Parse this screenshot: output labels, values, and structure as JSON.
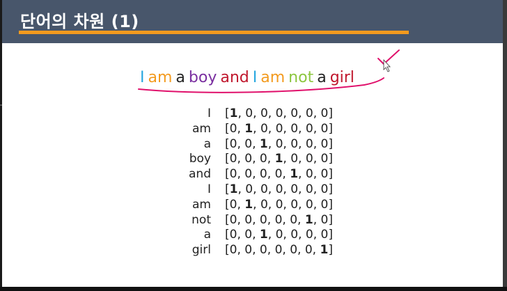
{
  "slide": {
    "title": "단어의 차원 (1)",
    "colors": {
      "title_bar": "#48566b",
      "title_underline": "#f39a1e",
      "annotation": "#e0106b"
    }
  },
  "sentence": {
    "words": [
      {
        "text": "I",
        "color": "#29a8e0"
      },
      {
        "text": "am",
        "color": "#f39a1e"
      },
      {
        "text": "a",
        "color": "#222222"
      },
      {
        "text": "boy",
        "color": "#7a2fa0"
      },
      {
        "text": "and",
        "color": "#c0162c"
      },
      {
        "text": "I",
        "color": "#29a8e0"
      },
      {
        "text": "am",
        "color": "#f39a1e"
      },
      {
        "text": "not",
        "color": "#8cc63f"
      },
      {
        "text": "a",
        "color": "#222222"
      },
      {
        "text": "girl",
        "color": "#c0162c"
      }
    ]
  },
  "encodings": [
    {
      "word": "I",
      "vector": [
        1,
        0,
        0,
        0,
        0,
        0,
        0
      ]
    },
    {
      "word": "am",
      "vector": [
        0,
        1,
        0,
        0,
        0,
        0,
        0
      ]
    },
    {
      "word": "a",
      "vector": [
        0,
        0,
        1,
        0,
        0,
        0,
        0
      ]
    },
    {
      "word": "boy",
      "vector": [
        0,
        0,
        0,
        1,
        0,
        0,
        0
      ]
    },
    {
      "word": "and",
      "vector": [
        0,
        0,
        0,
        0,
        1,
        0,
        0
      ]
    },
    {
      "word": "I",
      "vector": [
        1,
        0,
        0,
        0,
        0,
        0,
        0
      ]
    },
    {
      "word": "am",
      "vector": [
        0,
        1,
        0,
        0,
        0,
        0,
        0
      ]
    },
    {
      "word": "not",
      "vector": [
        0,
        0,
        0,
        0,
        0,
        1,
        0
      ]
    },
    {
      "word": "a",
      "vector": [
        0,
        0,
        1,
        0,
        0,
        0,
        0
      ]
    },
    {
      "word": "girl",
      "vector": [
        0,
        0,
        0,
        0,
        0,
        0,
        1
      ]
    }
  ]
}
